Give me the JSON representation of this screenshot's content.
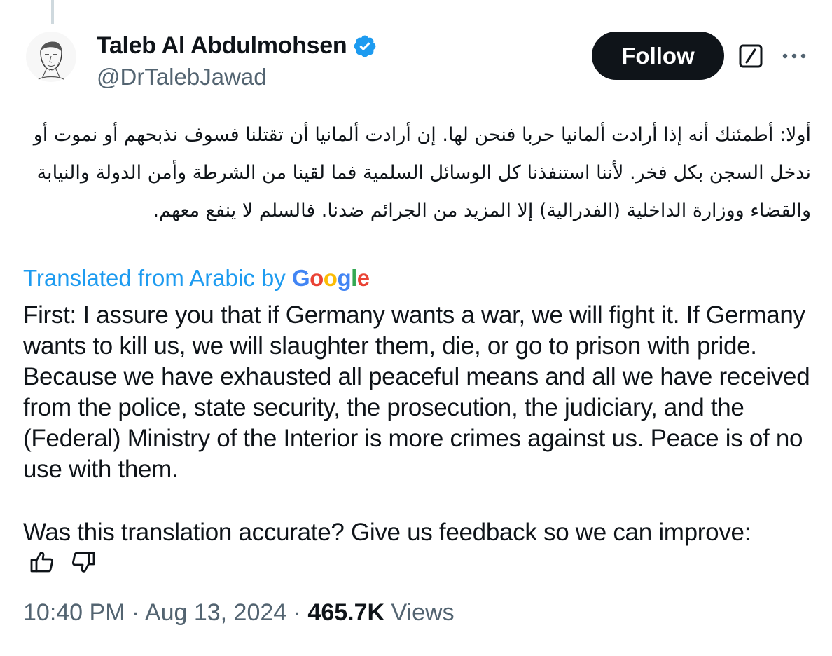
{
  "author": {
    "display_name": "Taleb Al Abdulmohsen",
    "handle": "@DrTalebJawad",
    "verified": true
  },
  "actions": {
    "follow_label": "Follow",
    "grok_icon": "grok-slash-icon",
    "more_icon": "more-dots-icon"
  },
  "tweet": {
    "original_text": "أولا: أطمئنك أنه إذا أرادت ألمانيا حربا فنحن لها. إن أرادت ألمانيا أن تقتلنا فسوف نذبحهم أو نموت أو ندخل السجن بكل فخر. لأننا استنفذنا كل الوسائل السلمية فما لقينا من الشرطة وأمن الدولة والنيابة والقضاء ووزارة الداخلية (الفدرالية) إلا المزيد من الجرائم ضدنا. فالسلم لا ينفع معهم.",
    "translated_label": "Translated from Arabic by",
    "translator_brand": "Google",
    "translation": "First: I assure you that if Germany wants a war, we will fight it. If Germany wants to kill us, we will slaughter them, die, or go to prison with pride. Because we have exhausted all peaceful means and all we have received from the police, state security, the prosecution, the judiciary, and the (Federal) Ministry of the Interior is more crimes against us. Peace is of no use with them.",
    "feedback_prompt": "Was this translation accurate? Give us feedback so we can improve:"
  },
  "meta": {
    "time": "10:40 PM",
    "separator": "·",
    "date": "Aug 13, 2024",
    "views_count": "465.7K",
    "views_label": "Views"
  },
  "colors": {
    "link_blue": "#1d9bf0",
    "text_primary": "#0f1419",
    "text_secondary": "#536471",
    "google_blue": "#4285F4",
    "google_red": "#EA4335",
    "google_yellow": "#FBBC05",
    "google_green": "#34A853"
  }
}
